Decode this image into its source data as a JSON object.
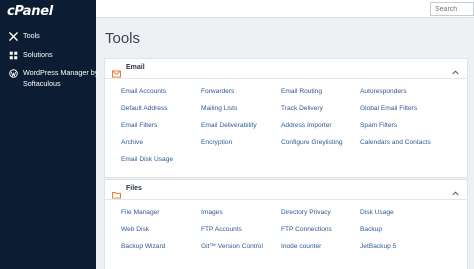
{
  "brand": {
    "logo": "cPanel"
  },
  "sidebar": {
    "items": [
      {
        "label": "Tools",
        "icon": "tools-icon"
      },
      {
        "label": "Solutions",
        "icon": "solutions-icon"
      },
      {
        "label": "WordPress Manager by Softaculous",
        "icon": "wordpress-icon"
      }
    ]
  },
  "search": {
    "placeholder": "Search"
  },
  "page": {
    "title": "Tools"
  },
  "email": {
    "title": "Email",
    "tools": [
      "Email Accounts",
      "Forwarders",
      "Email Routing",
      "Autoresponders",
      "Default Address",
      "Mailing Lists",
      "Track Delivery",
      "Global Email Filters",
      "Email Filters",
      "Email Deliverability",
      "Address Importer",
      "Spam Filters",
      "Archive",
      "Encryption",
      "Configure Greylisting",
      "Calendars and Contacts",
      "Email Disk Usage"
    ]
  },
  "files": {
    "title": "Files",
    "tools": [
      "File Manager",
      "Images",
      "Directory Privacy",
      "Disk Usage",
      "Web Disk",
      "FTP Accounts",
      "FTP Connections",
      "Backup",
      "Backup Wizard",
      "Git™ Version Control",
      "Inode counter",
      "JetBackup 5"
    ]
  },
  "colors": {
    "sidebar": "#0c1d33",
    "link": "#2d5a91",
    "accent": "#e8743b"
  }
}
